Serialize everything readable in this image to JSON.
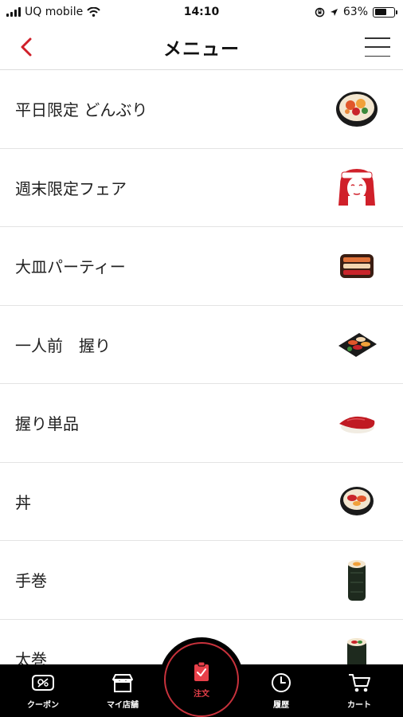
{
  "status_bar": {
    "carrier": "UQ mobile",
    "time": "14:10",
    "battery_percent": "63%",
    "battery_level": 0.63
  },
  "nav": {
    "title": "メニュー",
    "back_icon": "chevron-left-icon",
    "menu_icon": "hamburger-icon",
    "accent_color": "#d0202a"
  },
  "menu": {
    "items": [
      {
        "label": "平日限定 どんぶり",
        "icon": "donburi-bowl-icon"
      },
      {
        "label": "週末限定フェア",
        "icon": "fair-mascot-icon"
      },
      {
        "label": "大皿パーティー",
        "icon": "party-platter-icon"
      },
      {
        "label": "一人前　握り",
        "icon": "nigiri-set-icon"
      },
      {
        "label": "握り単品",
        "icon": "tuna-nigiri-icon"
      },
      {
        "label": "丼",
        "icon": "don-bowl-icon"
      },
      {
        "label": "手巻",
        "icon": "temaki-roll-icon"
      },
      {
        "label": "太巻",
        "icon": "futomaki-icon"
      }
    ]
  },
  "tab_bar": {
    "coupon": "クーポン",
    "my_store": "マイ店舗",
    "order": "注文",
    "history": "履歴",
    "cart": "カート",
    "active_color": "#e8404a"
  }
}
